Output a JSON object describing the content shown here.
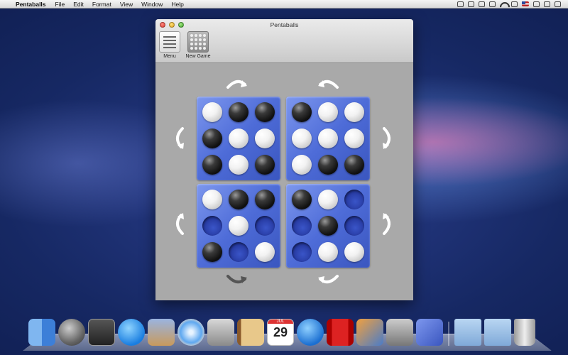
{
  "menubar": {
    "app_name": "Pentaballs",
    "items": [
      "File",
      "Edit",
      "Format",
      "View",
      "Window",
      "Help"
    ]
  },
  "window": {
    "title": "Pentaballs",
    "toolbar": [
      {
        "label": "Menu",
        "icon": "menu-list-icon"
      },
      {
        "label": "New Game",
        "icon": "new-game-grid-icon"
      }
    ]
  },
  "board": {
    "quadrants": [
      {
        "position": "top-left",
        "cells": [
          "white",
          "black",
          "black",
          "black",
          "white",
          "white",
          "black",
          "white",
          "black"
        ]
      },
      {
        "position": "top-right",
        "cells": [
          "black",
          "white",
          "white",
          "white",
          "white",
          "white",
          "white",
          "black",
          "black"
        ]
      },
      {
        "position": "bottom-left",
        "cells": [
          "white",
          "black",
          "black",
          "empty",
          "white",
          "empty",
          "black",
          "empty",
          "white"
        ]
      },
      {
        "position": "bottom-right",
        "cells": [
          "black",
          "white",
          "empty",
          "empty",
          "black",
          "empty",
          "empty",
          "white",
          "white"
        ]
      }
    ],
    "rotate_arrows": [
      {
        "id": "top-left-cw",
        "direction": "clockwise",
        "active": true
      },
      {
        "id": "top-right-ccw",
        "direction": "counterclockwise",
        "active": true
      },
      {
        "id": "left-top",
        "direction": "counterclockwise",
        "active": true
      },
      {
        "id": "right-top",
        "direction": "clockwise",
        "active": true
      },
      {
        "id": "left-bottom",
        "direction": "clockwise",
        "active": true
      },
      {
        "id": "right-bottom",
        "direction": "counterclockwise",
        "active": true
      },
      {
        "id": "bottom-left-ccw",
        "direction": "counterclockwise",
        "active": false
      },
      {
        "id": "bottom-right-cw",
        "direction": "clockwise",
        "active": true
      }
    ]
  },
  "colors": {
    "board_blue": "#4e6cd8",
    "window_gray": "#a9a9a9",
    "arrow_active": "#ffffff",
    "arrow_inactive": "#555555"
  },
  "dock": {
    "items": [
      "finder-icon",
      "launchpad-icon",
      "mission-control-icon",
      "app-store-icon",
      "mail-eagle-icon",
      "safari-icon",
      "facetime-icon",
      "address-book-icon",
      "ical-icon",
      "itunes-icon",
      "photo-booth-icon",
      "iphoto-icon",
      "system-preferences-icon",
      "pentaballs-icon",
      "applications-folder-icon",
      "downloads-folder-icon",
      "trash-icon"
    ],
    "ical_date": "29",
    "ical_month": "JUL"
  }
}
